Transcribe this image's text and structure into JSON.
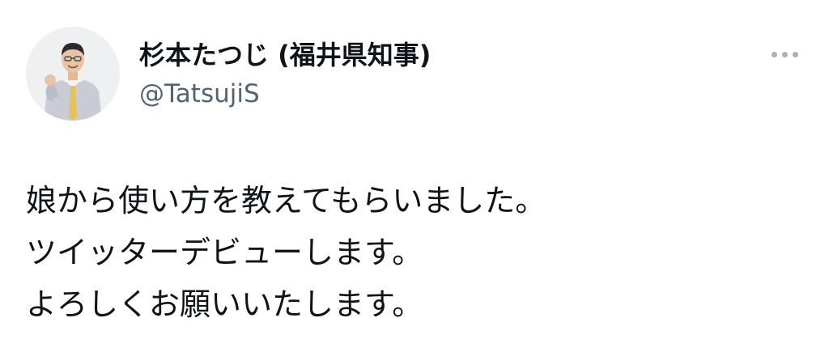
{
  "author": {
    "display_name": "杉本たつじ (福井県知事)",
    "handle": "@TatsujiS",
    "avatar_icon": "profile-photo"
  },
  "more_menu": {
    "icon": "more-horizontal-icon",
    "color": "#a9b2ba"
  },
  "tweet": {
    "lines": [
      "娘から使い方を教えてもらいました。",
      "ツイッターデビューします。",
      "よろしくお願いいたします。"
    ]
  },
  "colors": {
    "text": "#0f1419",
    "secondary_text": "#536471",
    "background": "#ffffff"
  }
}
